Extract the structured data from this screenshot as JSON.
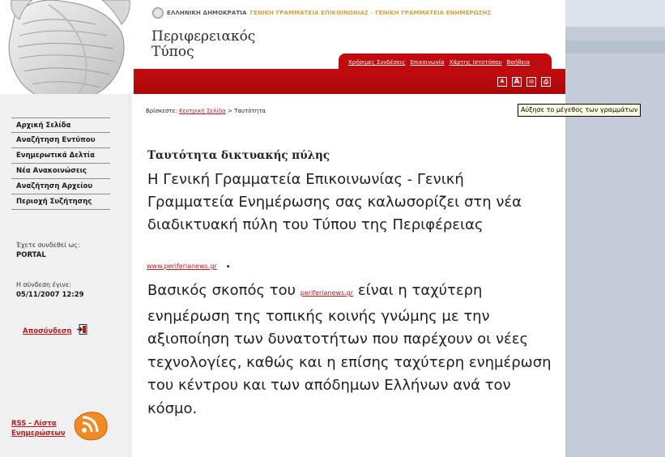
{
  "header": {
    "govt_part1": "ΕΛΛΗΝΙΚΗ ΔΗΜΟΚΡΑΤΙΑ",
    "govt_part2": "ΓΕΝΙΚΗ ΓΡΑΜΜΑΤΕΙΑ ΕΠΙΚΟΙΝΩΝΙΑΣ - ΓΕΝΙΚΗ ΓΡΑΜΜΑΤΕΙΑ ΕΝΗΜΕΡΩΣΗΣ",
    "logo_line1": "Περιφερειακός",
    "logo_line2": "Τύπος",
    "top_links": [
      "Χρήσιμες Συνδέσεις",
      "Επικοινωνία",
      "Χάρτης Ιστοτόπου",
      "Βοήθεια"
    ],
    "tools": [
      {
        "icon": "font-decrease-icon",
        "glyph": "A"
      },
      {
        "icon": "font-increase-icon",
        "glyph": "A"
      },
      {
        "icon": "email-icon",
        "glyph": "✉"
      },
      {
        "icon": "print-icon",
        "glyph": "⎙"
      }
    ]
  },
  "tooltip": "Αύξησε το μέγεθος των γραμμάτων",
  "sidebar": {
    "menu": [
      "Αρχική Σελίδα",
      "Αναζήτηση Εντύπου",
      "Ενημερωτικά Δελτία",
      "Νέα Ανακοινώσεις",
      "Αναζήτηση Αρχείου",
      "Περιοχή Συζήτησης"
    ],
    "connected_label": "Έχετε συνδεθεί ως:",
    "connected_user": "PORTAL",
    "last_login_label": "Η σύνδεση έγινε:",
    "last_login_date": "05/11/2007 12:29",
    "logout": "Αποσύνδεση",
    "rss_line1": "RSS - Λίστα",
    "rss_line2": "Ενημερώσεων"
  },
  "breadcrumb": {
    "prefix": "Βρίσκεστε:",
    "home": "Κεντρική Σελίδα",
    "separator": ">",
    "current": "Ταυτότητα"
  },
  "content": {
    "title": "Ταυτότητα δικτυακής πύλης",
    "para1": "Η Γενική Γραμματεία Επικοινωνίας - Γενική Γραμματεία Ενημέρωσης σας καλωσορίζει στη νέα διαδικτυακή πύλη του Τύπου της Περιφέρειας",
    "site_link": "www.periferianews.gr",
    "site_dot": ".",
    "para2_start": "Βασικός σκοπός του",
    "para2_link": "periferianews.gr",
    "para2_end": "είναι η ταχύτερη ενημέρωση της τοπικής κοινής γνώμης με την αξιοποίηση των δυνατοτήτων που παρέχουν οι νέες τεχνολογίες, καθώς και η επίσης ταχύτερη ενημέρωση του κέντρου και των απόδημων Ελλήνων ανά τον κόσμο."
  },
  "colors": {
    "brand_red": "#c40c10",
    "link_red": "#c0181c",
    "gold": "#d6a13a",
    "side_grey": "#c3ccd9"
  }
}
